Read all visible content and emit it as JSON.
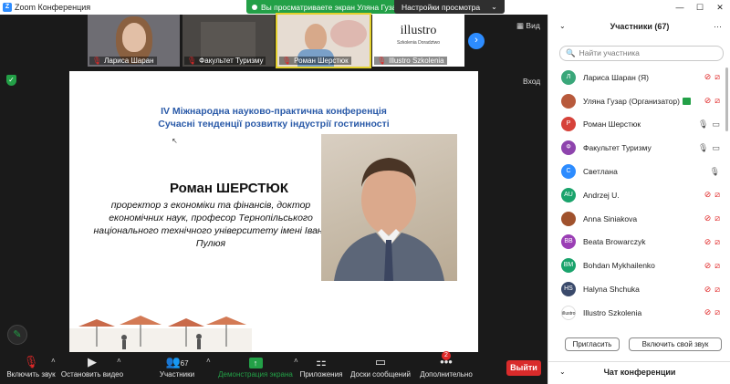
{
  "titlebar": {
    "title": "Zoom Конференция",
    "share_banner": "Вы просматриваете экран Уляна Гузар",
    "view_options": "Настройки просмотра",
    "minimize": "—",
    "maximize": "☐",
    "close": "✕"
  },
  "thumbnails": [
    {
      "label": "Лариса Шаран"
    },
    {
      "label": "Факультет Туризму"
    },
    {
      "label": "Роман Шерстюк"
    },
    {
      "label": "Illustro Szkolenia",
      "logo": "illustro",
      "logo_sub": "Szkolenia Doradztwo"
    }
  ],
  "video_toggle": "Вид",
  "enter_label": "Вход",
  "slide": {
    "conference_line1": "IV Міжнародна науково-практична конференція",
    "conference_line2": "Сучасні тенденції розвитку індустрії гостинності",
    "speaker_name": "Роман ШЕРСТЮК",
    "speaker_role": "проректор з економіки та фінансів, доктор економічних наук, професор Тернопільського національного технічного університету імені Івана Пулюя"
  },
  "toolbar": {
    "unmute": "Включить звук",
    "stop_video": "Остановить видео",
    "participants": "Участники",
    "participants_count": "67",
    "share_screen": "Демонстрация экрана",
    "apps": "Приложения",
    "whiteboards": "Доски сообщений",
    "more": "Дополнительно",
    "more_badge": "2",
    "leave": "Выйти"
  },
  "panel": {
    "title": "Участники (67)",
    "search_placeholder": "Найти участника",
    "invite": "Пригласить",
    "unmute_me": "Включить свой звук",
    "chat_title": "Чат конференции",
    "participants": [
      {
        "initials": "Л",
        "name": "Лариса Шаран (Я)",
        "color": "#3aa77a",
        "mic": "off",
        "cam": "off"
      },
      {
        "initials": "",
        "name": "Уляна Гузар (Организатор)",
        "color": "#b85a3c",
        "mic": "off",
        "cam": "off",
        "sharing": true
      },
      {
        "initials": "Р",
        "name": "Роман Шерстюк",
        "color": "#d6423a",
        "mic": "on",
        "cam": "on"
      },
      {
        "initials": "Ф",
        "name": "Факультет Туризму",
        "color": "#8e44ad",
        "mic": "on",
        "cam": "on"
      },
      {
        "initials": "С",
        "name": "Светлана",
        "color": "#2d8cff",
        "mic": "on",
        "cam": "none"
      },
      {
        "initials": "AU",
        "name": "Andrzej U.",
        "color": "#1aa36c",
        "mic": "off",
        "cam": "off"
      },
      {
        "initials": "",
        "name": "Anna Siniakova",
        "color": "#a0522d",
        "mic": "off",
        "cam": "off"
      },
      {
        "initials": "BB",
        "name": "Beata Browarczyk",
        "color": "#9b3fb5",
        "mic": "off",
        "cam": "off"
      },
      {
        "initials": "BM",
        "name": "Bohdan Mykhailenko",
        "color": "#1aa36c",
        "mic": "off",
        "cam": "off"
      },
      {
        "initials": "HS",
        "name": "Halyna Shchuka",
        "color": "#3a4a6b",
        "mic": "off",
        "cam": "off"
      },
      {
        "initials": "illustro",
        "name": "Illustro Szkolenia",
        "color": "#ffffff",
        "mic": "off",
        "cam": "off"
      }
    ]
  }
}
